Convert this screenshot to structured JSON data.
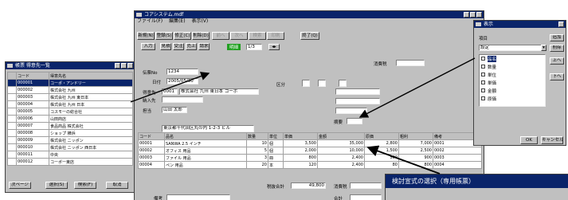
{
  "windows": {
    "list": {
      "title": "帳票 得意先一覧",
      "columns": [
        "コード",
        "得意先名"
      ],
      "rows": [
        {
          "code": "000001",
          "name": "コーポ・アンドリー"
        },
        {
          "code": "000002",
          "name": "株式会社 九州"
        },
        {
          "code": "000003",
          "name": "株式会社 九州 東日本"
        },
        {
          "code": "000004",
          "name": "株式会社 九州 日本"
        },
        {
          "code": "000005",
          "name": "コスモーの総合社"
        },
        {
          "code": "000006",
          "name": "山田商店"
        },
        {
          "code": "000007",
          "name": "食品商品 株式会社"
        },
        {
          "code": "000008",
          "name": "ショップ 横浜"
        },
        {
          "code": "000009",
          "name": "株式会社 ニッポン"
        },
        {
          "code": "000010",
          "name": "株式会社 ニッポン 西日本"
        },
        {
          "code": "000011",
          "name": "中央"
        },
        {
          "code": "000012",
          "name": "コーポー東店"
        }
      ],
      "buttons": [
        "次ページ",
        "選択(S)",
        "検索(F)",
        "取消"
      ]
    },
    "main": {
      "title": "コアシステム.mdf",
      "menu": [
        "ファイル(F)",
        "編集(E)",
        "表示(V)"
      ],
      "toolbar": [
        "新規(N)",
        "登録(S)",
        "修正(C)",
        "削除(D)",
        "前へ",
        "次へ",
        "検索",
        "印刷",
        "終了(Q)"
      ],
      "tabs": [
        "入力",
        "見積",
        "受注",
        "売上",
        "請求"
      ],
      "status": "明細",
      "counter": "1/3",
      "labels": {
        "slip_no": "伝票No",
        "date": "日付",
        "customer_code": "得意先",
        "customer_name": "得意先名",
        "person": "担当",
        "tax": "消費税",
        "delivery": "納入先",
        "class": "区分",
        "memo": "摘要"
      },
      "fields": {
        "slip_no": "1234",
        "date": "2005/05/30",
        "customer_code": "0001",
        "customer_name": "株式会社 九州 東日本 コーポ",
        "person": "山田 太郎",
        "tax_box": "",
        "address": "東京都千代田区丸の内 1-2-3 ビル"
      },
      "detail_columns": [
        "コード",
        "品名",
        "数量",
        "単位",
        "単価",
        "金額",
        "原価",
        "粗利",
        "備考"
      ],
      "detail_rows": [
        {
          "code": "00001",
          "name": "SANWA 2.5 インチ",
          "qty": "10",
          "unit": "個",
          "price": "3,500",
          "amount": "35,000",
          "cost": "2,800",
          "profit": "7,000",
          "note": "0001"
        },
        {
          "code": "00002",
          "name": "オフィス 用品",
          "qty": "5",
          "unit": "個",
          "price": "2,000",
          "amount": "10,000",
          "cost": "1,500",
          "profit": "2,500",
          "note": "0002"
        },
        {
          "code": "00003",
          "name": "ファイル 用品",
          "qty": "3",
          "unit": "冊",
          "price": "800",
          "amount": "2,400",
          "cost": "500",
          "profit": "900",
          "note": "0003"
        },
        {
          "code": "00004",
          "name": "ペン 用品",
          "qty": "20",
          "unit": "本",
          "price": "120",
          "amount": "2,400",
          "cost": "80",
          "profit": "800",
          "note": "0004"
        }
      ],
      "footer": {
        "subtotal_label": "税抜合計",
        "subtotal": "49,800",
        "tax_label": "消費税",
        "total_label": "合計",
        "remarks_label": "備考"
      }
    },
    "right": {
      "title": "表示",
      "dropdown_label": "項目",
      "dropdown_value": "設定",
      "items": [
        "品名",
        "数量",
        "単位",
        "単価",
        "金額",
        "原価"
      ],
      "side_buttons": [
        "追加",
        "削除",
        "上へ",
        "下へ"
      ],
      "buttons": [
        "OK",
        "キャンセル"
      ]
    },
    "popup": {
      "title": "検討宣式の選択（専用帳票）"
    }
  },
  "colors": {
    "titlebar": "#0a246a",
    "window_bg": "#c0c0c0",
    "arrow": "#000000"
  }
}
